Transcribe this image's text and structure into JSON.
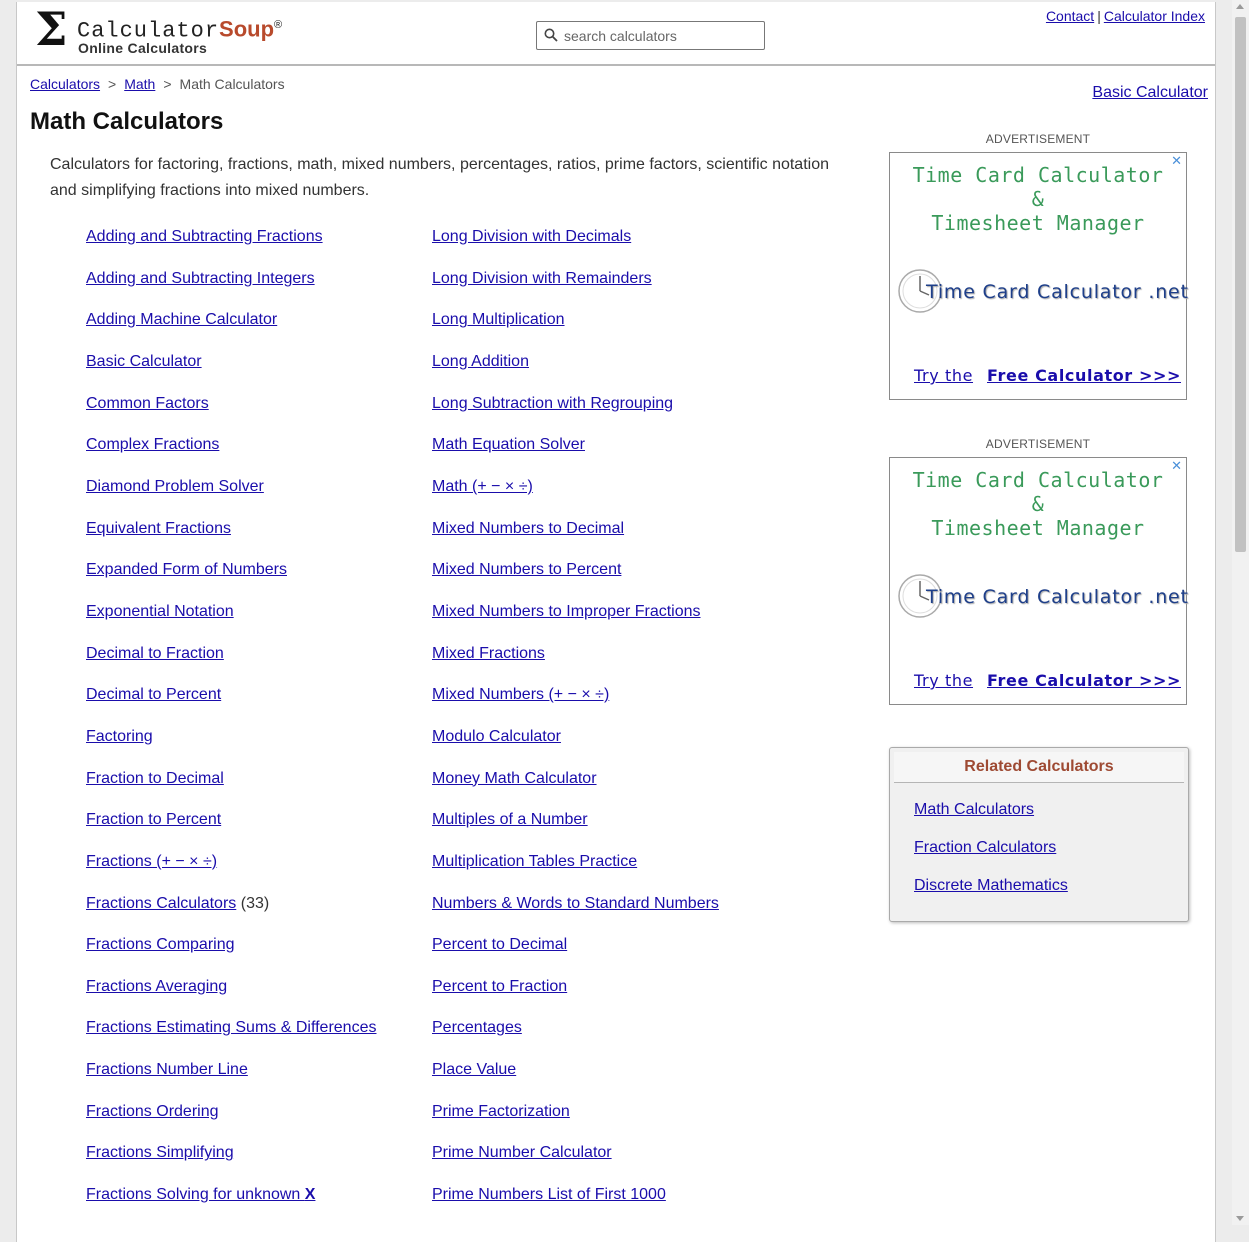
{
  "header": {
    "brand_part1": "Calculator",
    "brand_part2": "Soup",
    "registered": "®",
    "tagline": "Online Calculators",
    "search_placeholder": "search calculators",
    "contact": "Contact",
    "separator": "|",
    "calculator_index": "Calculator Index"
  },
  "breadcrumb": {
    "calculators": "Calculators",
    "math": "Math",
    "current": "Math Calculators",
    "sep": ">"
  },
  "basic_calculator_link": "Basic Calculator",
  "page_title": "Math Calculators",
  "intro": "Calculators for factoring, fractions, math, mixed numbers, percentages, ratios, prime factors, scientific notation and simplifying fractions into mixed numbers.",
  "left_links": [
    "Adding and Subtracting Fractions",
    "Adding and Subtracting Integers",
    "Adding Machine Calculator",
    "Basic Calculator",
    "Common Factors",
    "Complex Fractions",
    "Diamond Problem Solver",
    "Equivalent Fractions",
    "Expanded Form of Numbers",
    "Exponential Notation",
    "Decimal to Fraction",
    "Decimal to Percent",
    "Factoring",
    "Fraction to Decimal",
    "Fraction to Percent",
    "Fractions (+ − × ÷)",
    "Fractions Calculators",
    "Fractions Comparing",
    "Fractions Averaging",
    "Fractions Estimating Sums & Differences",
    "Fractions Number Line",
    "Fractions Ordering",
    "Fractions Simplifying",
    "Fractions Solving for unknown "
  ],
  "fractions_calculators_count": "(33)",
  "unknown_x": "X",
  "right_links": [
    "Long Division with Decimals",
    "Long Division with Remainders",
    "Long Multiplication",
    "Long Addition",
    "Long Subtraction with Regrouping",
    "Math Equation Solver",
    "Math (+ − × ÷)",
    "Mixed Numbers to Decimal",
    "Mixed Numbers to Percent",
    "Mixed Numbers to Improper Fractions",
    "Mixed Fractions",
    "Mixed Numbers (+ − × ÷)",
    "Modulo Calculator",
    "Money Math Calculator",
    "Multiples of a Number",
    "Multiplication Tables Practice",
    "Numbers & Words to Standard Numbers",
    "Percent to Decimal",
    "Percent to Fraction",
    "Percentages",
    "Place Value",
    "Prime Factorization",
    "Prime Number Calculator",
    "Prime Numbers List of First 1000"
  ],
  "ads": [
    {
      "label": "ADVERTISEMENT",
      "close": "✕",
      "headline_line1": "Time Card Calculator",
      "headline_line2": "&",
      "headline_line3": "Timesheet Manager",
      "site": "Time Card Calculator .net",
      "cta_prefix": "Try the",
      "cta_main": "Free Calculator >>>"
    },
    {
      "label": "ADVERTISEMENT",
      "close": "✕",
      "headline_line1": "Time Card Calculator",
      "headline_line2": "&",
      "headline_line3": "Timesheet Manager",
      "site": "Time Card Calculator .net",
      "cta_prefix": "Try the",
      "cta_main": "Free Calculator >>>"
    }
  ],
  "related": {
    "title": "Related Calculators",
    "links": [
      "Math Calculators",
      "Fraction Calculators",
      "Discrete Mathematics"
    ]
  },
  "colors": {
    "link": "#1a0dab",
    "brand_accent": "#b84a2c",
    "ad_headline": "#3a9a5a",
    "related_title": "#9e4a33"
  },
  "icons": {
    "search": "search-icon",
    "logo": "sigma-logo-icon",
    "clock": "clock-icon"
  }
}
